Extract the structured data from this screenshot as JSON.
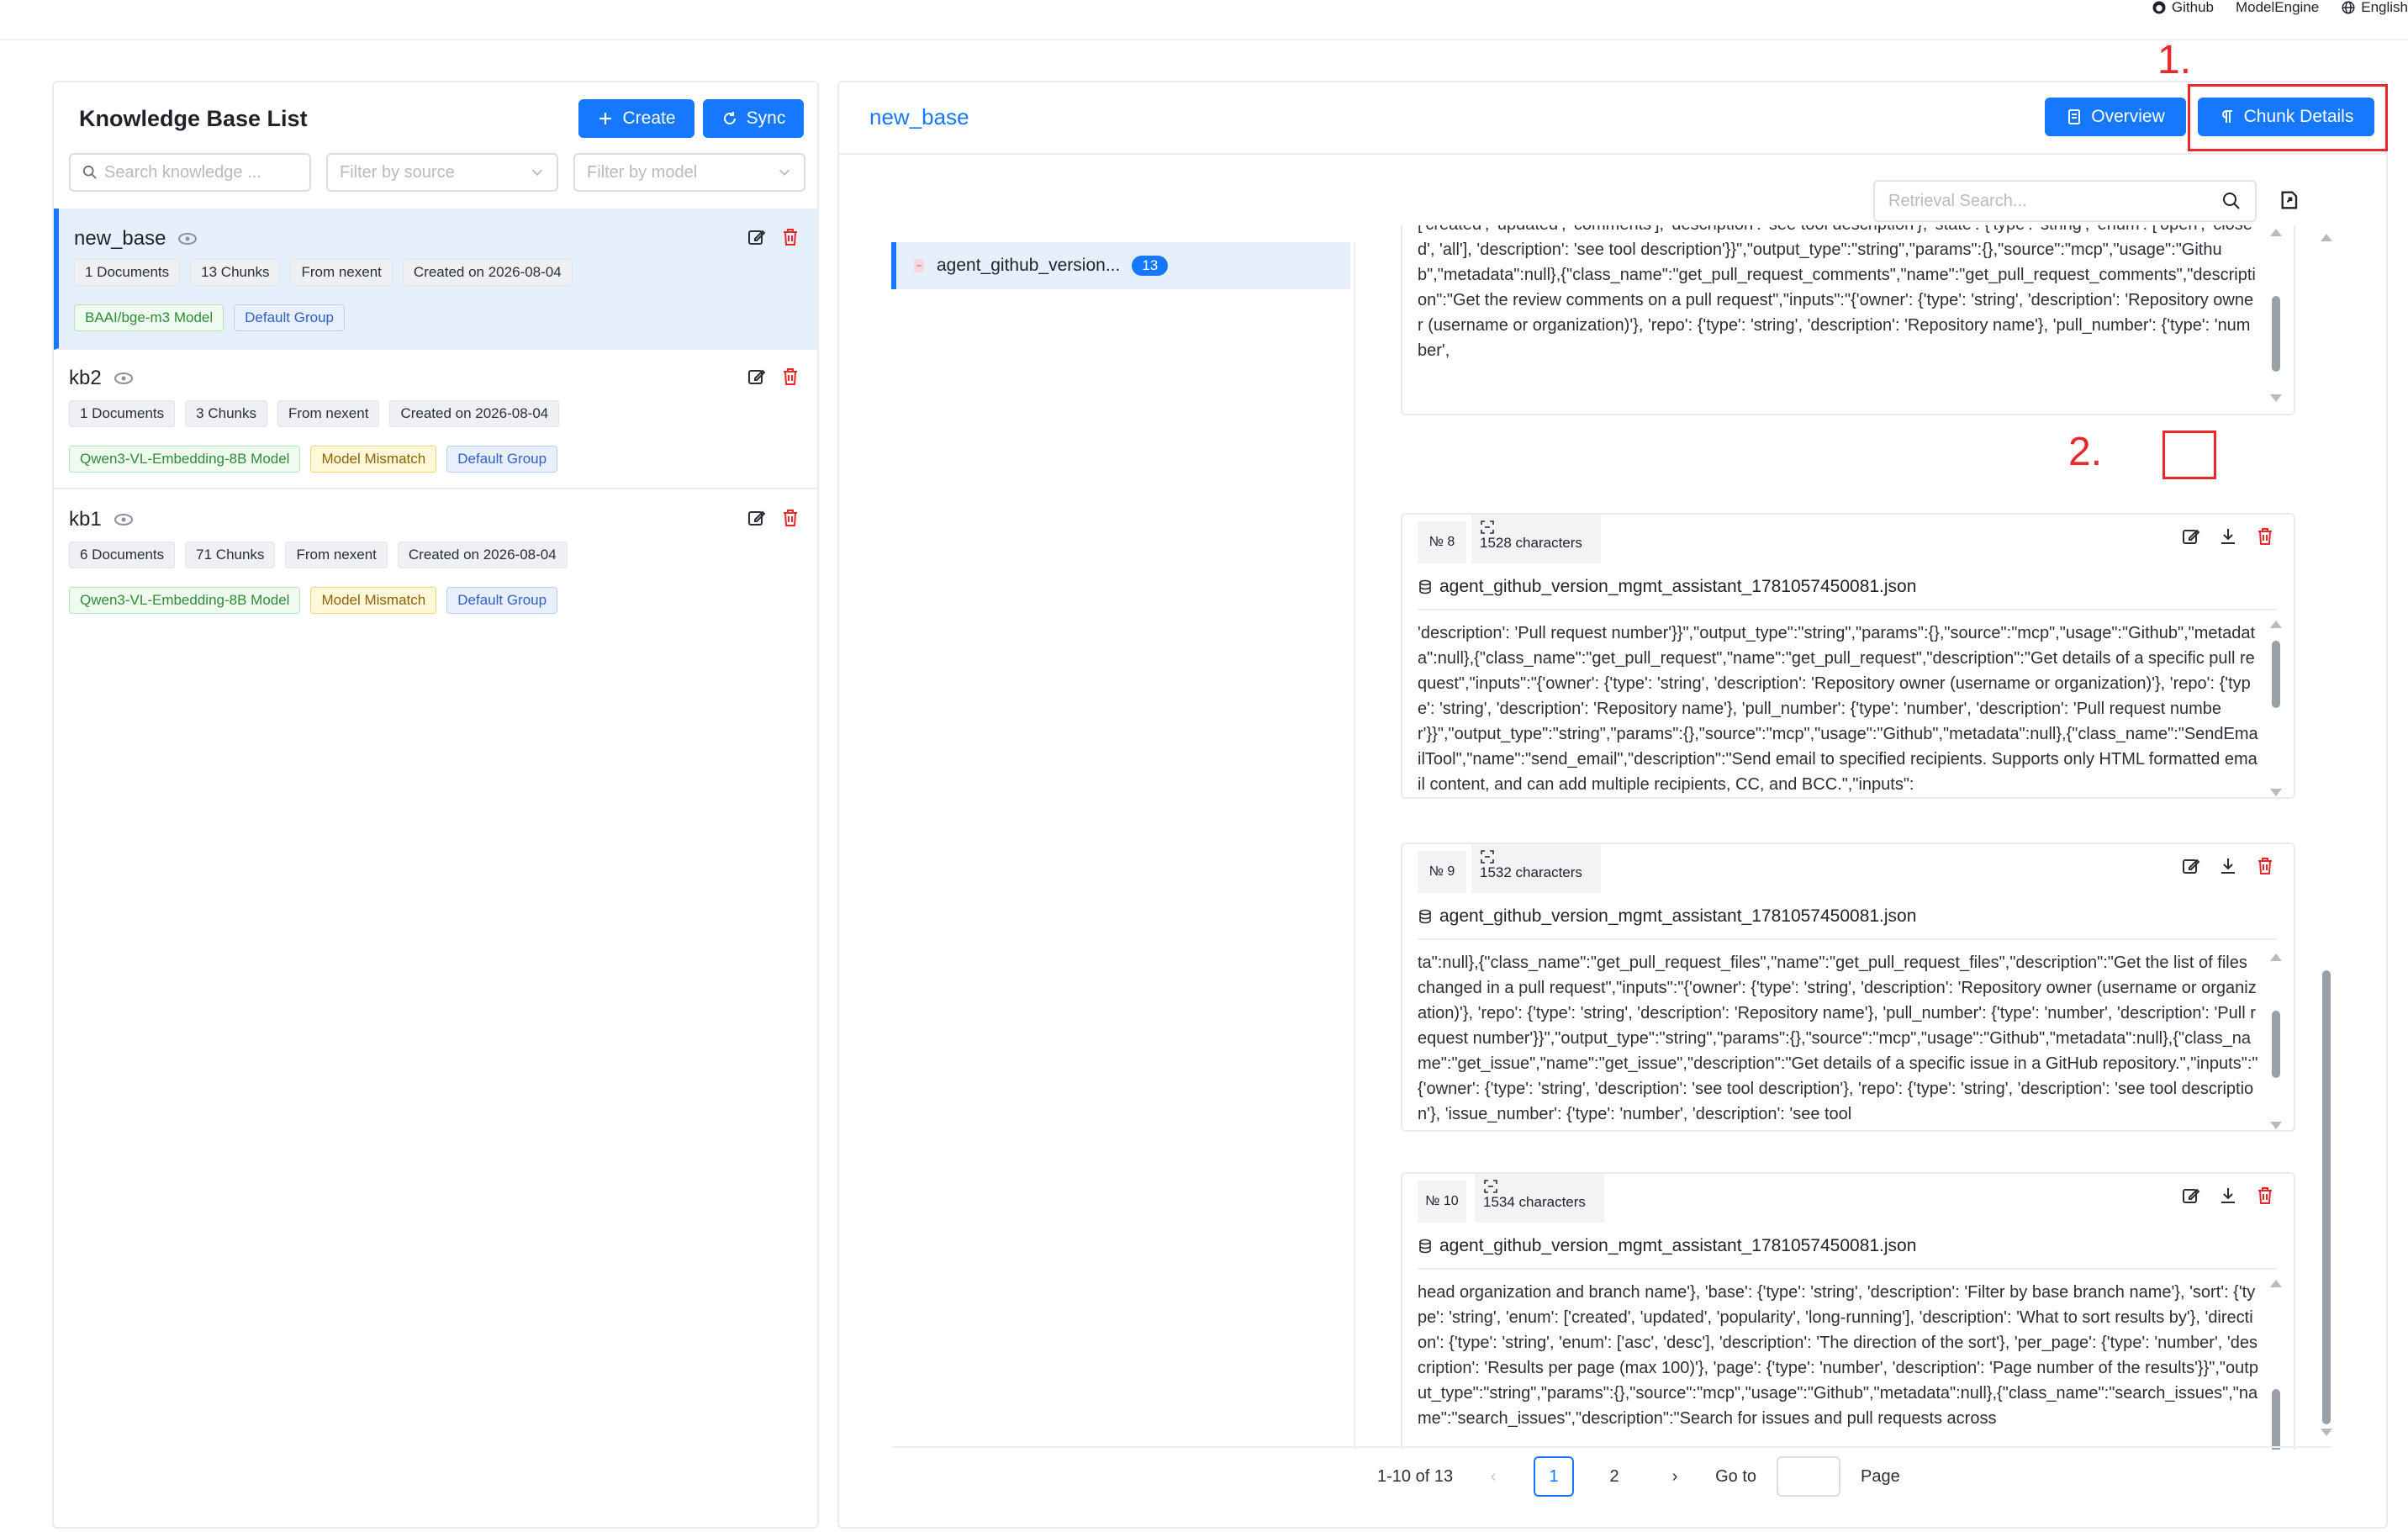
{
  "topbar": {
    "links": [
      "Github",
      "ModelEngine",
      "English"
    ]
  },
  "left": {
    "title": "Knowledge Base List",
    "create_label": "Create",
    "sync_label": "Sync",
    "search_placeholder": "Search knowledge ...",
    "filter_source": "Filter by source",
    "filter_model": "Filter by model",
    "items": [
      {
        "name": "new_base",
        "tags": [
          "1 Documents",
          "13 Chunks",
          "From nexent",
          "Created on 2026-08-04"
        ],
        "model": "BAAI/bge-m3 Model",
        "mismatch": "",
        "group": "Default Group"
      },
      {
        "name": "kb2",
        "tags": [
          "1 Documents",
          "3 Chunks",
          "From nexent",
          "Created on 2026-08-04"
        ],
        "model": "Qwen3-VL-Embedding-8B Model",
        "mismatch": "Model Mismatch",
        "group": "Default Group"
      },
      {
        "name": "kb1",
        "tags": [
          "6 Documents",
          "71 Chunks",
          "From nexent",
          "Created on 2026-08-04"
        ],
        "model": "Qwen3-VL-Embedding-8B Model",
        "mismatch": "Model Mismatch",
        "group": "Default Group"
      }
    ]
  },
  "right": {
    "base_name": "new_base",
    "overview_label": "Overview",
    "chunk_details_label": "Chunk Details",
    "retrieval_placeholder": "Retrieval Search...",
    "doc": {
      "name": "agent_github_version...",
      "count": "13"
    },
    "partial_chunk_text": "['created', 'updated', 'comments'], 'description': 'see tool description'}, 'state': {'type': 'string', 'enum': ['open', 'closed', 'all'], 'description': 'see tool description'}}\",\"output_type\":\"string\",\"params\":{},\"source\":\"mcp\",\"usage\":\"Github\",\"metadata\":null},{\"class_name\":\"get_pull_request_comments\",\"name\":\"get_pull_request_comments\",\"description\":\"Get the review comments on a pull request\",\"inputs\":\"{'owner': {'type': 'string', 'description': 'Repository owner (username or organization)'}, 'repo': {'type': 'string', 'description': 'Repository name'}, 'pull_number': {'type': 'number',",
    "chunks": [
      {
        "no": "№ 8",
        "chars": "1528 characters",
        "file": "agent_github_version_mgmt_assistant_1781057450081.json",
        "text": "'description': 'Pull request number'}}\",\"output_type\":\"string\",\"params\":{},\"source\":\"mcp\",\"usage\":\"Github\",\"metadata\":null},{\"class_name\":\"get_pull_request\",\"name\":\"get_pull_request\",\"description\":\"Get details of a specific pull request\",\"inputs\":\"{'owner': {'type': 'string', 'description': 'Repository owner (username or organization)'}, 'repo': {'type': 'string', 'description': 'Repository name'}, 'pull_number': {'type': 'number', 'description': 'Pull request number'}}\",\"output_type\":\"string\",\"params\":{},\"source\":\"mcp\",\"usage\":\"Github\",\"metadata\":null},{\"class_name\":\"SendEmailTool\",\"name\":\"send_email\",\"description\":\"Send email to specified recipients. Supports only HTML formatted email content, and can add multiple recipients, CC, and BCC.\",\"inputs\":"
      },
      {
        "no": "№ 9",
        "chars": "1532 characters",
        "file": "agent_github_version_mgmt_assistant_1781057450081.json",
        "text": "ta\":null},{\"class_name\":\"get_pull_request_files\",\"name\":\"get_pull_request_files\",\"description\":\"Get the list of files changed in a pull request\",\"inputs\":\"{'owner': {'type': 'string', 'description': 'Repository owner (username or organization)'}, 'repo': {'type': 'string', 'description': 'Repository name'}, 'pull_number': {'type': 'number', 'description': 'Pull request number'}}\",\"output_type\":\"string\",\"params\":{},\"source\":\"mcp\",\"usage\":\"Github\",\"metadata\":null},{\"class_name\":\"get_issue\",\"name\":\"get_issue\",\"description\":\"Get details of a specific issue in a GitHub repository.\",\"inputs\":\"{'owner': {'type': 'string', 'description': 'see tool description'}, 'repo': {'type': 'string', 'description': 'see tool description'}, 'issue_number': {'type': 'number', 'description': 'see tool"
      },
      {
        "no": "№ 10",
        "chars": "1534 characters",
        "file": "agent_github_version_mgmt_assistant_1781057450081.json",
        "text": "head organization and branch name'}, 'base': {'type': 'string', 'description': 'Filter by base branch name'}, 'sort': {'type': 'string', 'enum': ['created', 'updated', 'popularity', 'long-running'], 'description': 'What to sort results by'}, 'direction': {'type': 'string', 'enum': ['asc', 'desc'], 'description': 'The direction of the sort'}, 'per_page': {'type': 'number', 'description': 'Results per page (max 100)'}, 'page': {'type': 'number', 'description': 'Page number of the results'}}\",\"output_type\":\"string\",\"params\":{},\"source\":\"mcp\",\"usage\":\"Github\",\"metadata\":null},{\"class_name\":\"search_issues\",\"name\":\"search_issues\",\"description\":\"Search for issues and pull requests across"
      }
    ],
    "pagination": {
      "range": "1-10 of 13",
      "pages": [
        "1",
        "2"
      ],
      "goto_label": "Go to",
      "page_label": "Page"
    }
  },
  "annotations": {
    "step1": "1.",
    "step2": "2."
  },
  "colors": {
    "primary": "#1677ff",
    "danger": "#e8282a"
  }
}
